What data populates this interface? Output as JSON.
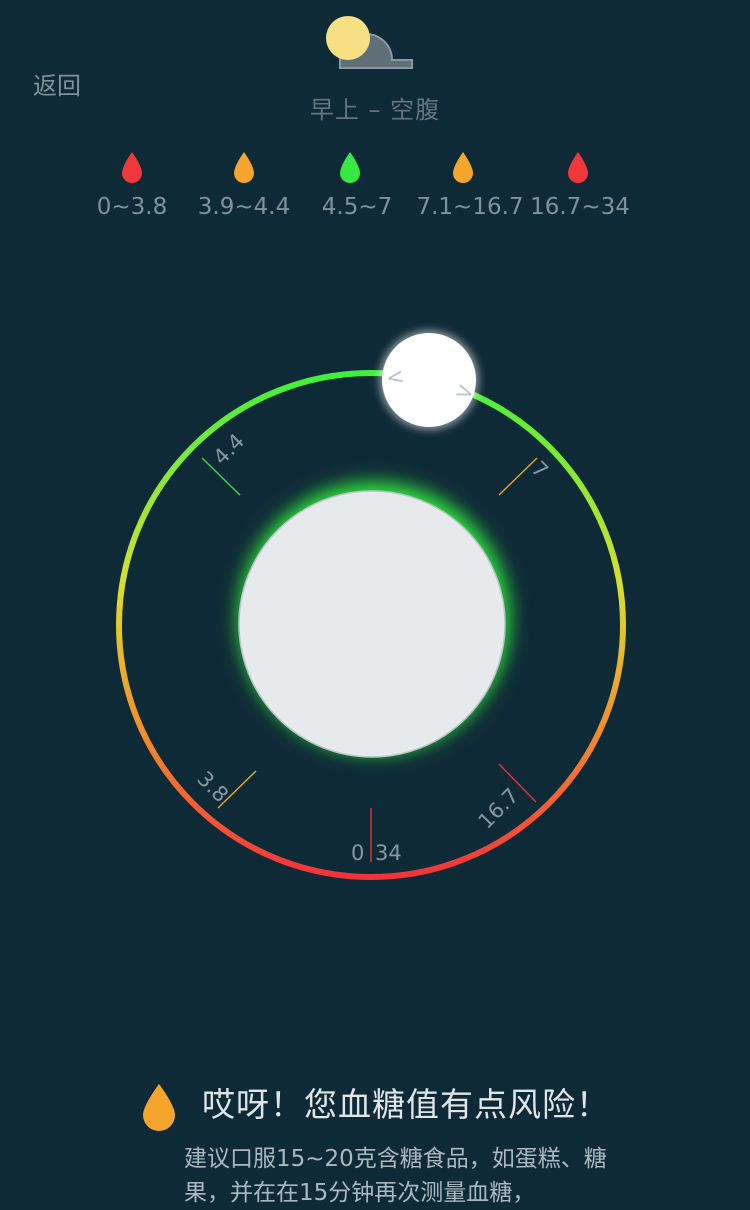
{
  "nav": {
    "back_label": "返回"
  },
  "header": {
    "period_label": "早上 – 空腹",
    "weather_icon": "sun-behind-cloud-icon"
  },
  "legend": [
    {
      "range": "0~3.8",
      "color": "#f0373b"
    },
    {
      "range": "3.9~4.4",
      "color": "#f6a52c"
    },
    {
      "range": "4.5~7",
      "color": "#35e843"
    },
    {
      "range": "7.1~16.7",
      "color": "#f6a52c"
    },
    {
      "range": "16.7~34",
      "color": "#f0373b"
    }
  ],
  "dial": {
    "tick_labels": {
      "low": "3.8",
      "mid_low": "4.4",
      "normal_high": "7",
      "high": "16.7",
      "zero": "0",
      "max": "34"
    },
    "knob_left": "<",
    "knob_right": ">",
    "center_value": "",
    "colors": {
      "green": "#3ef03c",
      "yellow": "#d9df2e",
      "orange": "#f58a2c",
      "red": "#f0333a",
      "center_fill": "#e6eaed"
    }
  },
  "alert": {
    "icon": "blood-drop-icon",
    "icon_color": "#f6a52c",
    "title": "哎呀！您血糖值有点风险！",
    "message": "建议口服15~20克含糖食品，如蛋糕、糖果，并在在15分钟再次测量血糖，"
  }
}
